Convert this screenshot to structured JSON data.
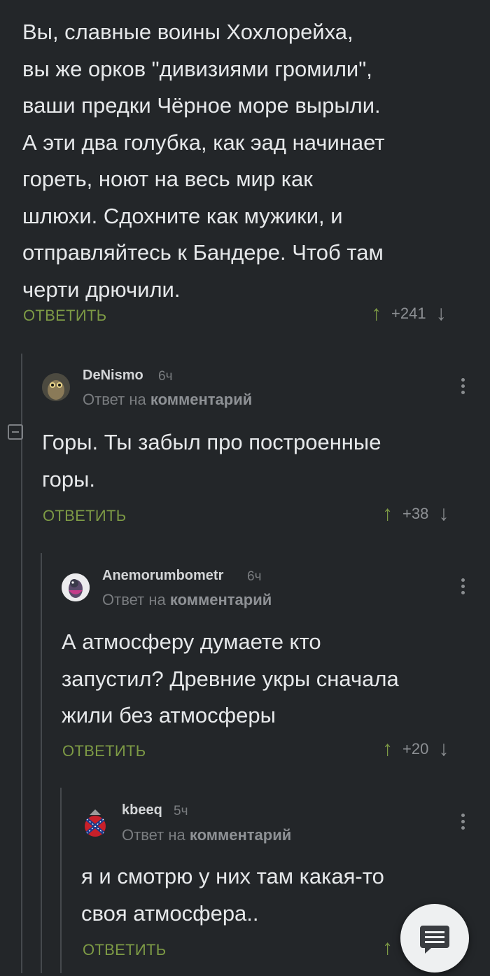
{
  "comments": [
    {
      "text_lines": [
        "Вы, славные воины Хохлорейха,",
        "вы же орков \"дивизиями громили\",",
        "ваши предки Чёрное море вырыли.",
        "А эти два голубка, как эад начинает",
        "гореть, ноют на весь мир как",
        "шлюхи. Сдохните как мужики, и",
        "отправляйтесь к Бандере. Чтоб там",
        "черти дрючили."
      ],
      "reply_label": "ОТВЕТИТЬ",
      "score": "+241"
    },
    {
      "username": "DeNismo",
      "time": "6ч",
      "reply_to_prefix": "Ответ на",
      "reply_to_target": "комментарий",
      "text_lines": [
        "Горы. Ты забыл про построенные",
        "горы."
      ],
      "reply_label": "ОТВЕТИТЬ",
      "score": "+38"
    },
    {
      "username": "Anemorumbometr",
      "time": "6ч",
      "reply_to_prefix": "Ответ на",
      "reply_to_target": "комментарий",
      "text_lines": [
        "А атмосферу думаете кто",
        "запустил? Древние укры сначала",
        "жили без атмосферы"
      ],
      "reply_label": "ОТВЕТИТЬ",
      "score": "+20"
    },
    {
      "username": "kbeeq",
      "time": "5ч",
      "reply_to_prefix": "Ответ на",
      "reply_to_target": "комментарий",
      "text_lines": [
        "я и смотрю у них там какая-то",
        "своя атмосфера.."
      ],
      "reply_label": "ОТВЕТИТЬ",
      "score": ""
    }
  ],
  "icons": {
    "upvote": "arrow-up-icon",
    "downvote": "arrow-down-icon",
    "more": "more-vertical-icon",
    "collapse": "collapse-minus-icon",
    "fab": "comment-icon"
  },
  "arrows": {
    "up": "↑",
    "down": "↓"
  },
  "colors": {
    "background": "#232629",
    "accent": "#7d9a45",
    "text": "#e6e8ea",
    "muted": "#7a7d80"
  }
}
